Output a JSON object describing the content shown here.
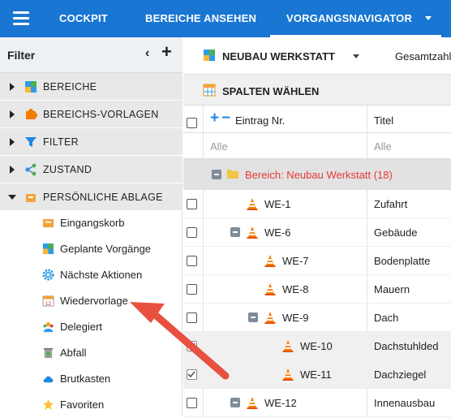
{
  "topbar": {
    "nav": [
      {
        "label": "COCKPIT"
      },
      {
        "label": "BEREICHE ANSEHEN"
      },
      {
        "label": "VORGANGSNAVIGATOR"
      }
    ]
  },
  "sidebar": {
    "title": "Filter",
    "sections": [
      {
        "label": "BEREICHE",
        "icon": "puzzle-icon"
      },
      {
        "label": "BEREICHS-VORLAGEN",
        "icon": "puzzle-orange-icon"
      },
      {
        "label": "FILTER",
        "icon": "funnel-icon"
      },
      {
        "label": "ZUSTAND",
        "icon": "share-icon"
      },
      {
        "label": "PERSÖNLICHE ABLAGE",
        "icon": "inbox-icon"
      }
    ],
    "items": [
      {
        "label": "Eingangskorb",
        "icon": "inbox-tray-icon"
      },
      {
        "label": "Geplante Vorgänge",
        "icon": "puzzle-plan-icon"
      },
      {
        "label": "Nächste Aktionen",
        "icon": "gear-icon"
      },
      {
        "label": "Wiedervorlage",
        "icon": "calendar-icon"
      },
      {
        "label": "Delegiert",
        "icon": "people-icon"
      },
      {
        "label": "Abfall",
        "icon": "trash-icon"
      },
      {
        "label": "Brutkasten",
        "icon": "cloud-icon"
      },
      {
        "label": "Favoriten",
        "icon": "star-icon"
      }
    ]
  },
  "main": {
    "area": "NEUBAU WERKSTATT",
    "gesamt": "Gesamtzahl",
    "columns_button": "SPALTEN WÄHLEN",
    "headers": {
      "entry": "Eintrag Nr.",
      "title": "Titel"
    },
    "filters": {
      "entry": "Alle",
      "title": "Alle"
    },
    "group": "Bereich: Neubau Werkstatt (18)",
    "rows": [
      {
        "id": "WE-1",
        "title": "Zufahrt"
      },
      {
        "id": "WE-6",
        "title": "Gebäude"
      },
      {
        "id": "WE-7",
        "title": "Bodenplatte"
      },
      {
        "id": "WE-8",
        "title": "Mauern"
      },
      {
        "id": "WE-9",
        "title": "Dach"
      },
      {
        "id": "WE-10",
        "title": "Dachstuhlded"
      },
      {
        "id": "WE-11",
        "title": "Dachziegel"
      },
      {
        "id": "WE-12",
        "title": "Innenausbau"
      }
    ]
  },
  "colors": {
    "accent": "#1976d2",
    "group_text": "#e53935",
    "arrow": "#e8513f"
  }
}
